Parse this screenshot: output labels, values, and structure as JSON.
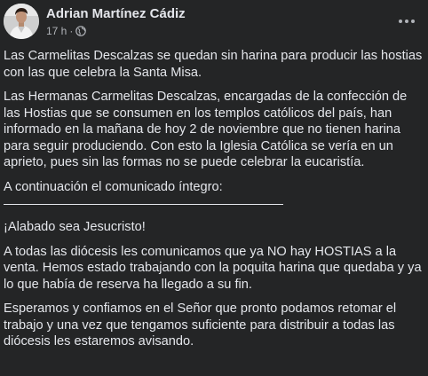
{
  "post": {
    "author": "Adrian Martínez Cádiz",
    "time": "17 h",
    "separator": "·",
    "privacy_icon": "globe-icon",
    "more_icon": "more-options-icon",
    "paragraphs": [
      "Las Carmelitas Descalzas se quedan sin harina para producir las hostias con las que celebra la Santa Misa.",
      "Las Hermanas Carmelitas Descalzas, encargadas de la confección de las Hostias que se consumen en los templos católicos del país, han informado en la mañana de hoy 2 de noviembre que no tienen harina para seguir produciendo. Con esto la Iglesia Católica se vería en un aprieto, pues sin las formas no se puede celebrar la eucaristía.",
      "A continuación el comunicado íntegro:",
      "¡Alabado sea Jesucristo!",
      "A todas las diócesis  les comunicamos que ya NO hay HOSTIAS a la venta. Hemos estado trabajando con la poquita harina que quedaba y ya lo que había de reserva ha llegado a su fin.",
      "Esperamos y confiamos en el Señor que pronto podamos retomar el trabajo y una vez que tengamos suficiente para distribuir a todas las diócesis les estaremos avisando."
    ]
  },
  "colors": {
    "background": "#242526",
    "primary_text": "#e4e6eb",
    "secondary_text": "#b0b3b8"
  }
}
